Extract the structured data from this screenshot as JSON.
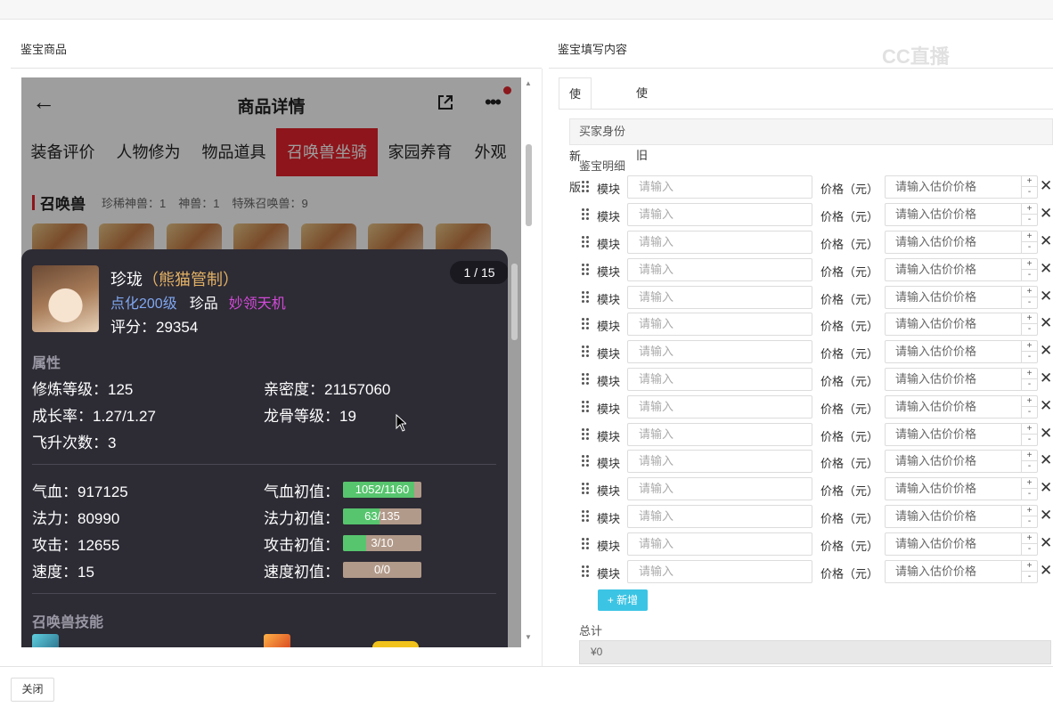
{
  "left_title": "鉴宝商品",
  "right_title": "鉴宝填写内容",
  "watermark": "CC直播",
  "phone": {
    "back_icon": "←",
    "title": "商品详情",
    "more_icon": "•••",
    "tabs": [
      "装备评价",
      "人物修为",
      "物品道具",
      "召唤兽坐骑",
      "家园养育",
      "外观"
    ],
    "active_tab": "召唤兽坐骑",
    "sub_title": "召唤兽",
    "sub_stats": [
      "珍稀神兽：1",
      "神兽：1",
      "特殊召唤兽：9"
    ]
  },
  "card": {
    "name": "珍珑",
    "name_tag": "（熊猫管制）",
    "level": "点化200级",
    "rarity": "珍品",
    "skill_tag": "妙领天机",
    "score": "评分：29354",
    "page": "1 / 15",
    "attr_title": "属性",
    "attrs": [
      "修炼等级：125",
      "亲密度：21157060",
      "成长率：1.27/1.27",
      "龙骨等级：19",
      "飞升次数：3"
    ],
    "stats": [
      {
        "label": "气血：917125",
        "init_label": "气血初值：",
        "bar": "1052/1160",
        "fill": 0.907
      },
      {
        "label": "法力：80990",
        "init_label": "法力初值：",
        "bar": "63/135",
        "fill": 0.467
      },
      {
        "label": "攻击：12655",
        "init_label": "攻击初值：",
        "bar": "3/10",
        "fill": 0.3
      },
      {
        "label": "速度：15",
        "init_label": "速度初值：",
        "bar": "0/0",
        "fill": 0
      }
    ],
    "skills_title": "召唤兽技能"
  },
  "form": {
    "tab_new": "使用新版",
    "tab_old": "使用旧版",
    "buyer_label": "买家身份",
    "detail_label": "鉴宝明细",
    "row_module": "模块",
    "row_placeholder": "请输入",
    "row_price_label": "价格（元）",
    "row_price_placeholder": "请输入估价价格",
    "step_up": "+",
    "step_down": "-",
    "remove_icon": "✕",
    "add_button": "+ 新增",
    "total_label": "总计",
    "total_value": "¥0"
  },
  "close_button": "关闭"
}
